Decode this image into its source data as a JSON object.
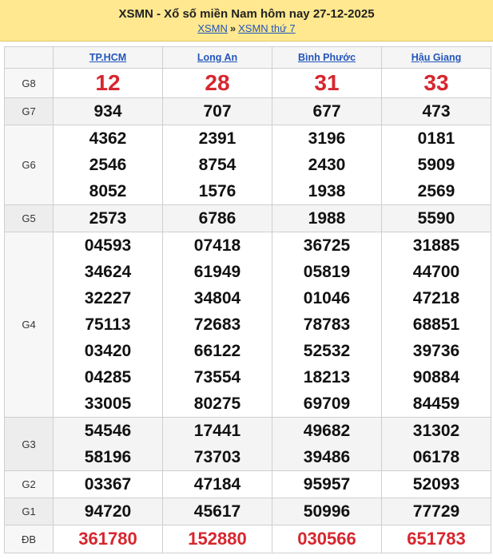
{
  "header": {
    "title": "XSMN - Xổ số miền Nam hôm nay 27-12-2025",
    "crumb_1": "XSMN",
    "separator": "»",
    "crumb_2": "XSMN thứ 7"
  },
  "provinces": [
    "TP.HCM",
    "Long An",
    "Bình Phước",
    "Hậu Giang"
  ],
  "rows": [
    {
      "label": "G8",
      "cells": [
        [
          "12"
        ],
        [
          "28"
        ],
        [
          "31"
        ],
        [
          "33"
        ]
      ]
    },
    {
      "label": "G7",
      "cells": [
        [
          "934"
        ],
        [
          "707"
        ],
        [
          "677"
        ],
        [
          "473"
        ]
      ]
    },
    {
      "label": "G6",
      "cells": [
        [
          "4362",
          "2546",
          "8052"
        ],
        [
          "2391",
          "8754",
          "1576"
        ],
        [
          "3196",
          "2430",
          "1938"
        ],
        [
          "0181",
          "5909",
          "2569"
        ]
      ]
    },
    {
      "label": "G5",
      "cells": [
        [
          "2573"
        ],
        [
          "6786"
        ],
        [
          "1988"
        ],
        [
          "5590"
        ]
      ]
    },
    {
      "label": "G4",
      "cells": [
        [
          "04593",
          "34624",
          "32227",
          "75113",
          "03420",
          "04285",
          "33005"
        ],
        [
          "07418",
          "61949",
          "34804",
          "72683",
          "66122",
          "73554",
          "80275"
        ],
        [
          "36725",
          "05819",
          "01046",
          "78783",
          "52532",
          "18213",
          "69709"
        ],
        [
          "31885",
          "44700",
          "47218",
          "68851",
          "39736",
          "90884",
          "84459"
        ]
      ]
    },
    {
      "label": "G3",
      "cells": [
        [
          "54546",
          "58196"
        ],
        [
          "17441",
          "73703"
        ],
        [
          "49682",
          "39486"
        ],
        [
          "31302",
          "06178"
        ]
      ]
    },
    {
      "label": "G2",
      "cells": [
        [
          "03367"
        ],
        [
          "47184"
        ],
        [
          "95957"
        ],
        [
          "52093"
        ]
      ]
    },
    {
      "label": "G1",
      "cells": [
        [
          "94720"
        ],
        [
          "45617"
        ],
        [
          "50996"
        ],
        [
          "77729"
        ]
      ]
    },
    {
      "label": "ĐB",
      "cells": [
        [
          "361780"
        ],
        [
          "152880"
        ],
        [
          "030566"
        ],
        [
          "651783"
        ]
      ]
    }
  ],
  "colors": {
    "header_bg": "#ffe88f",
    "special": "#d7262e",
    "link": "#2255bb"
  }
}
